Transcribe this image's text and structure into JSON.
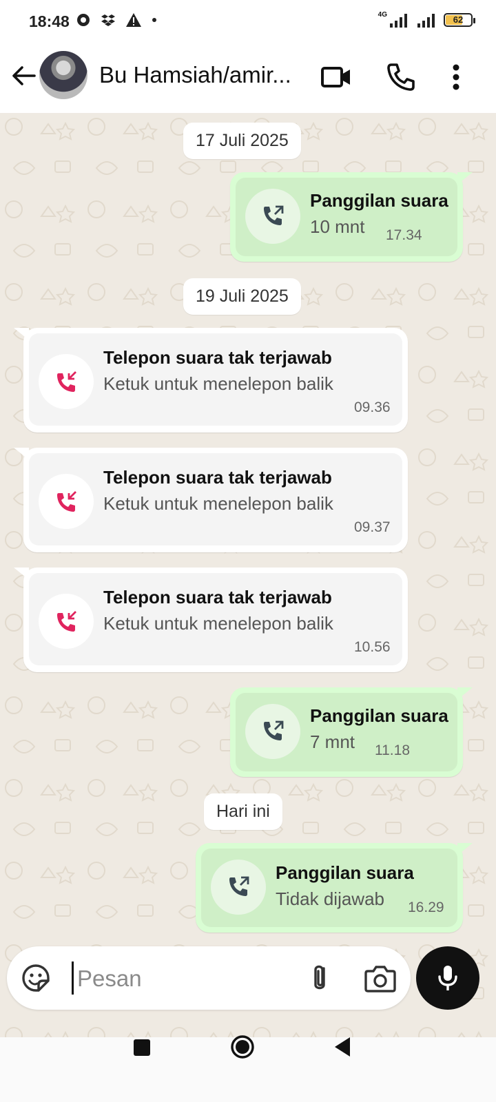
{
  "status_bar": {
    "time": "18:48",
    "network": "4G",
    "battery": "62",
    "battery_level": 0.62,
    "icons": [
      "whatsapp-status-icon",
      "dropbox-icon",
      "warning-icon",
      "dot-icon",
      "signal-icon",
      "signal-icon",
      "battery-icon"
    ]
  },
  "header": {
    "contact_name": "Bu Hamsiah/amir...",
    "icons": [
      "back-arrow-icon",
      "video-call-icon",
      "voice-call-icon",
      "more-vert-icon"
    ]
  },
  "chat": {
    "date_chips": [
      "17 Juli 2025",
      "19 Juli 2025",
      "Hari ini"
    ],
    "messages": [
      {
        "direction": "out",
        "title": "Panggilan suara",
        "subtitle": "10 mnt",
        "time": "17.34"
      },
      {
        "direction": "in",
        "title": "Telepon suara tak terjawab",
        "subtitle": "Ketuk untuk menelepon balik",
        "time": "09.36"
      },
      {
        "direction": "in",
        "title": "Telepon suara tak terjawab",
        "subtitle": "Ketuk untuk menelepon balik",
        "time": "09.37"
      },
      {
        "direction": "in",
        "title": "Telepon suara tak terjawab",
        "subtitle": "Ketuk untuk menelepon balik",
        "time": "10.56"
      },
      {
        "direction": "out",
        "title": "Panggilan suara",
        "subtitle": "7 mnt",
        "time": "11.18"
      },
      {
        "direction": "out",
        "title": "Panggilan suara",
        "subtitle": "Tidak dijawab",
        "time": "16.29"
      }
    ]
  },
  "input": {
    "placeholder": "Pesan",
    "value": ""
  },
  "colors": {
    "outgoing_bubble": "#d9fdd3",
    "missed_call": "#e0245e",
    "chat_background": "#efeae2"
  }
}
